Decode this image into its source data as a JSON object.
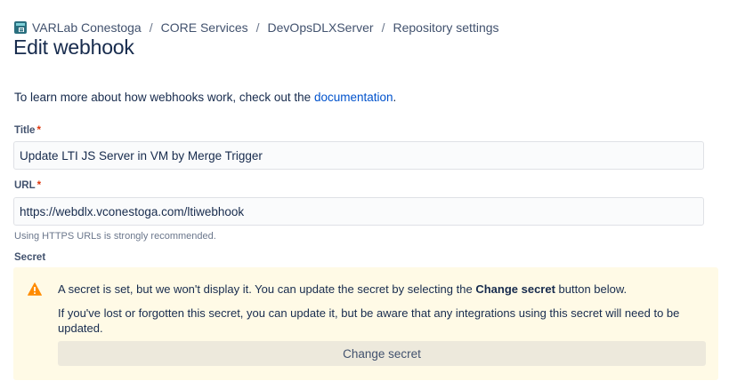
{
  "breadcrumb": {
    "items": [
      "VARLab Conestoga",
      "CORE Services",
      "DevOpsDLXServer",
      "Repository settings"
    ],
    "separator": "/",
    "workspace_icon": "repository-icon"
  },
  "page_title": "Edit webhook",
  "intro": {
    "text_before": "To learn more about how webhooks work, check out the ",
    "link_text": "documentation",
    "text_after": "."
  },
  "form": {
    "title_label": "Title",
    "title_value": "Update LTI JS Server in VM by Merge Trigger",
    "url_label": "URL",
    "url_value": "https://webdlx.vconestoga.com/ltiwebhook",
    "url_helper": "Using HTTPS URLs is strongly recommended.",
    "secret_label": "Secret",
    "required_mark": "*"
  },
  "secret_notice": {
    "icon": "warning-icon",
    "line1_before": "A secret is set, but we won't display it. You can update the secret by selecting the ",
    "line1_bold": "Change secret",
    "line1_after": " button below.",
    "line2": "If you've lost or forgotten this secret, you can update it, but be aware that any integrations using this secret will need to be updated.",
    "button_label": "Change secret"
  },
  "colors": {
    "link": "#0052cc",
    "required": "#de350b",
    "warning_bg": "#fffae6",
    "warning_icon": "#ff8b00",
    "text": "#172b4d"
  }
}
